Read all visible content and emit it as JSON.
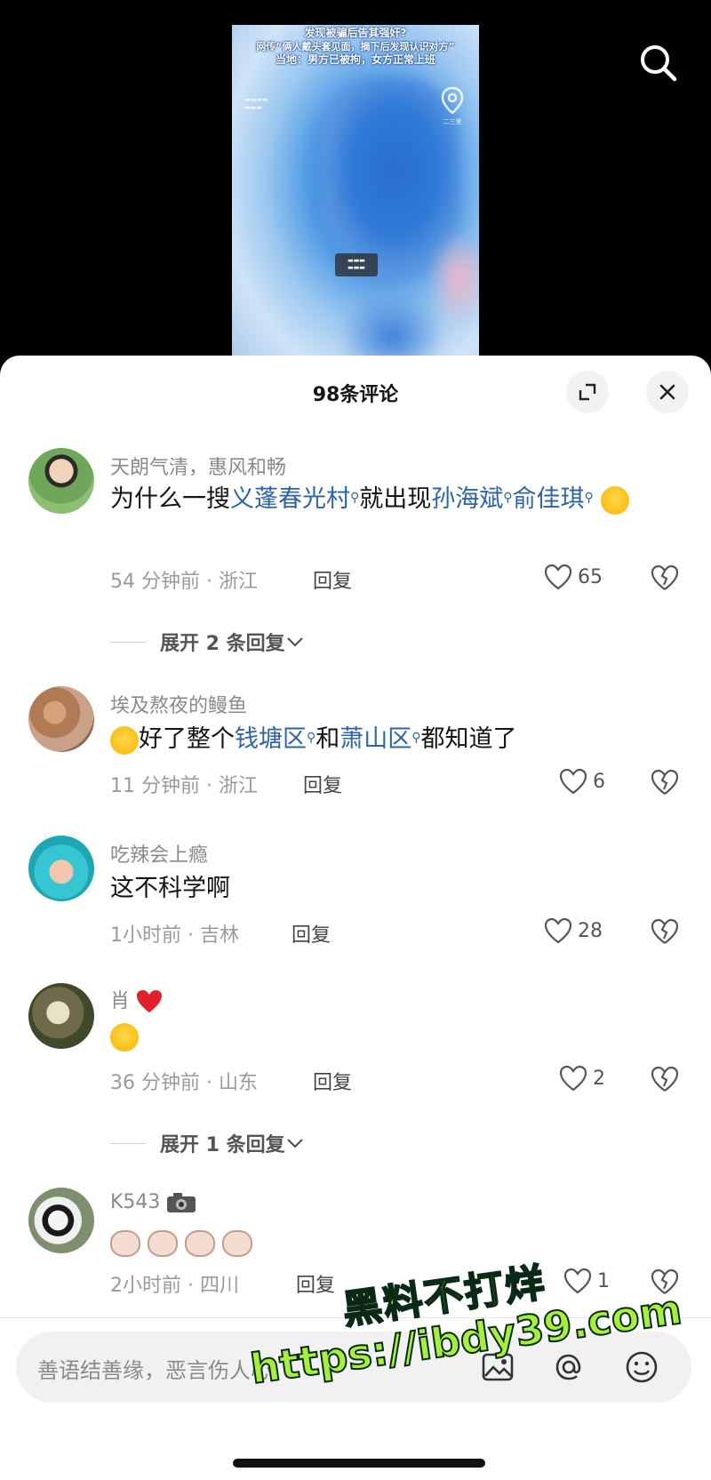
{
  "video": {
    "caption_line1": "发现被骗后告其强奸?",
    "caption_line2": "网传“俩人戴头套见面，摘下后发现认识对方”",
    "caption_line3": "当地：男方已被拘，女方正常上班",
    "pin_label": "二三里"
  },
  "sheet": {
    "title": "98条评论"
  },
  "comments": [
    {
      "nickname": "天朗气清，惠风和畅",
      "text_a": "为什么一搜",
      "kw1": "义蓬春光村",
      "text_b": "就出现",
      "kw2": "孙海斌",
      "kw3": "俞佳琪",
      "time_loc": "54 分钟前 · 浙江",
      "reply_label": "回复",
      "likes": "65"
    },
    {
      "nickname": "埃及熬夜的鳗鱼",
      "text_a": "好了整个",
      "kw1": "钱塘区",
      "text_b": "和",
      "kw2": "萧山区",
      "text_c": "都知道了",
      "time_loc": "11 分钟前 · 浙江",
      "reply_label": "回复",
      "likes": "6"
    },
    {
      "nickname": "吃辣会上瘾",
      "text": "这不科学啊",
      "time_loc": "1小时前 · 吉林",
      "reply_label": "回复",
      "likes": "28"
    },
    {
      "nickname": "肖",
      "time_loc": "36 分钟前 · 山东",
      "reply_label": "回复",
      "likes": "2"
    },
    {
      "nickname": "K543",
      "time_loc": "2小时前 · 四川",
      "reply_label": "回复",
      "likes": "1"
    }
  ],
  "expand_1": "展开 2 条回复",
  "expand_2": "展开 1 条回复",
  "input": {
    "placeholder": "善语结善缘，恶言伤人心"
  },
  "watermark": {
    "line1": "黑料不打烊",
    "line2": "https://ibdy39.com"
  },
  "colors": {
    "keyword": "#2b64a8",
    "watermark": "#a7ee3e",
    "heart": "#e0202a"
  }
}
